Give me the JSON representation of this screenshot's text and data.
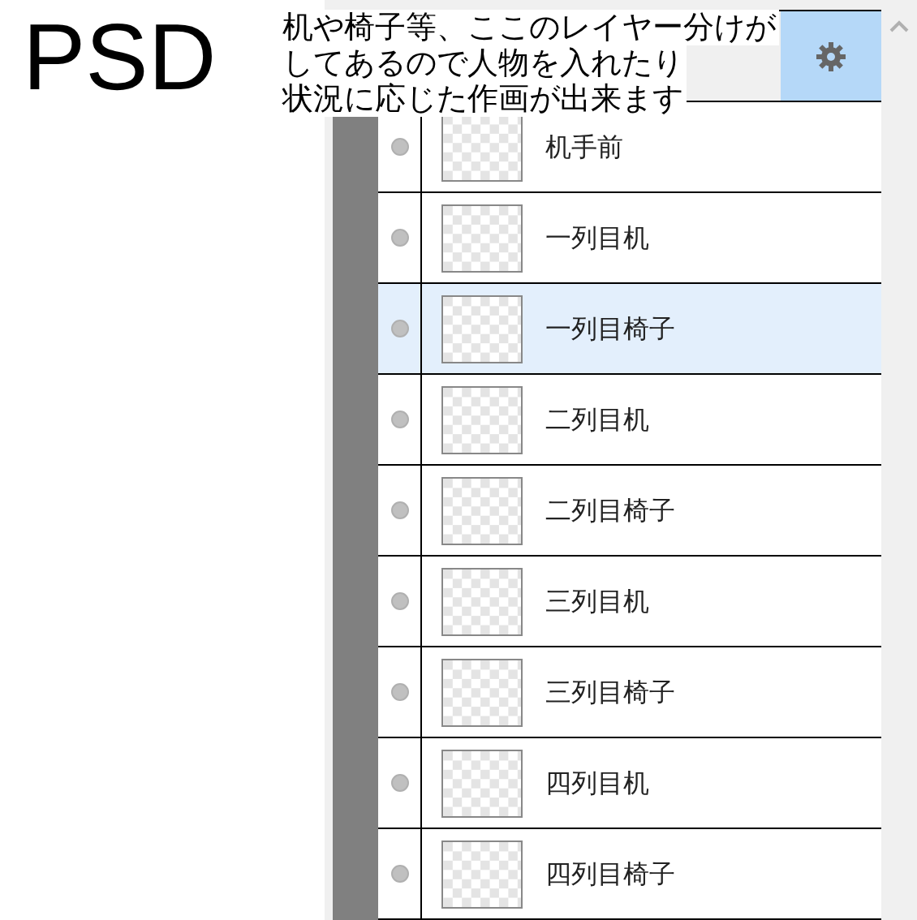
{
  "title": "PSD",
  "caption": [
    "机や椅子等、ここのレイヤー分けが",
    "してあるので人物を入れたり",
    "状況に応じた作画が出来ます"
  ],
  "layers": [
    {
      "selected": true,
      "hovered": false
    },
    {
      "name": "机手前",
      "selected": false,
      "hovered": false
    },
    {
      "name": "一列目机",
      "selected": false,
      "hovered": false
    },
    {
      "name": "一列目椅子",
      "selected": false,
      "hovered": true
    },
    {
      "name": "二列目机",
      "selected": false,
      "hovered": false
    },
    {
      "name": "二列目椅子",
      "selected": false,
      "hovered": false
    },
    {
      "name": "三列目机",
      "selected": false,
      "hovered": false
    },
    {
      "name": "三列目椅子",
      "selected": false,
      "hovered": false
    },
    {
      "name": "四列目机",
      "selected": false,
      "hovered": false
    },
    {
      "name": "四列目椅子",
      "selected": false,
      "hovered": false
    }
  ]
}
